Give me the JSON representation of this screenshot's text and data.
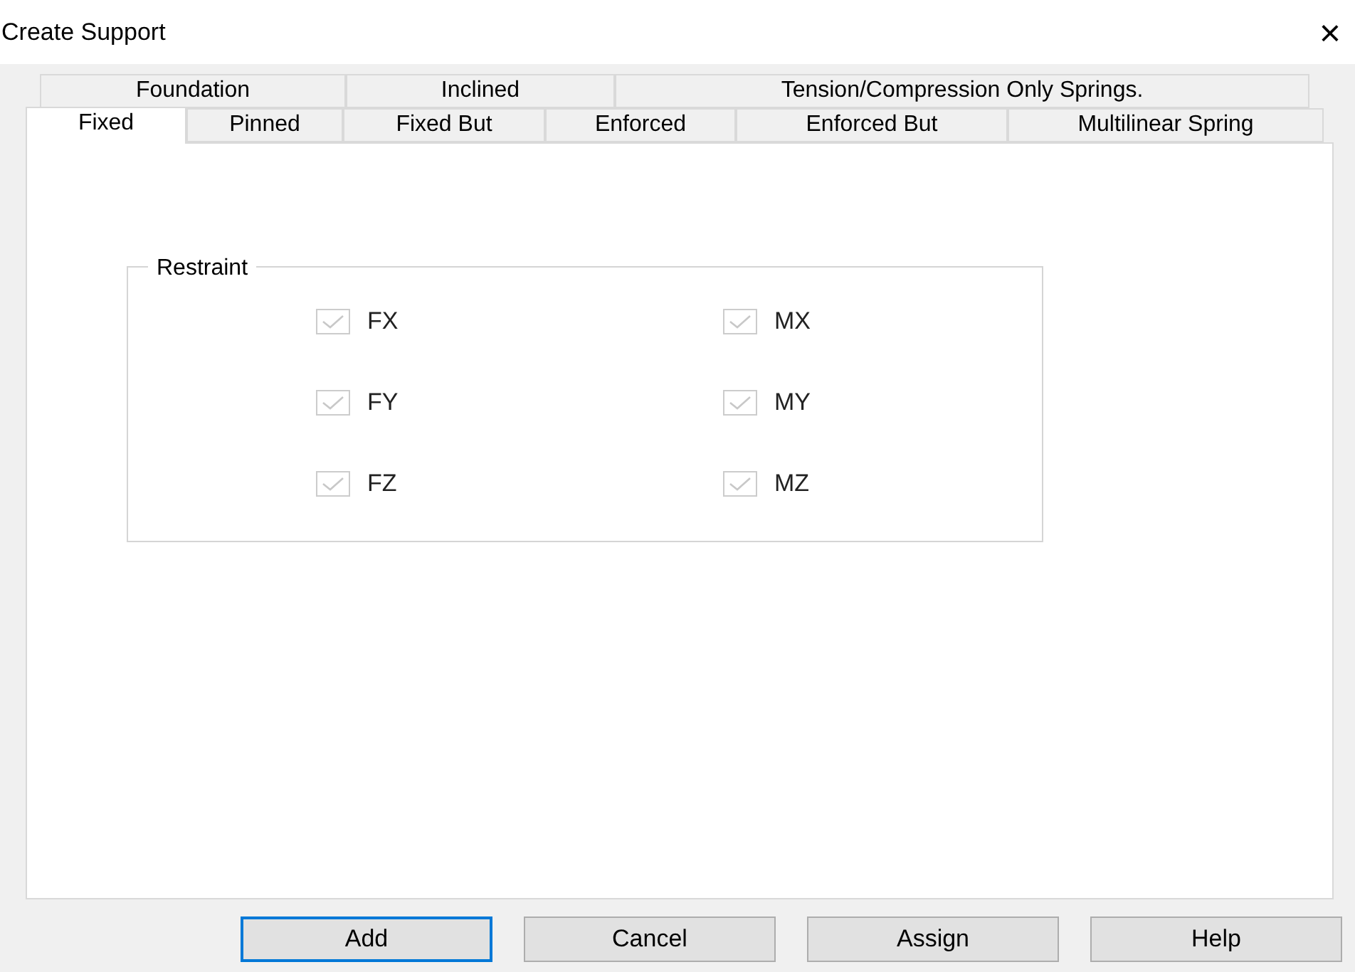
{
  "window": {
    "title": "Create Support",
    "close": "×"
  },
  "tab_rows": [
    {
      "tabs": [
        {
          "label": "Foundation",
          "selected": false
        },
        {
          "label": "Inclined",
          "selected": false
        },
        {
          "label": "Tension/Compression Only Springs.",
          "selected": false
        }
      ]
    },
    {
      "tabs": [
        {
          "label": "Fixed",
          "selected": true
        },
        {
          "label": "Pinned",
          "selected": false
        },
        {
          "label": "Fixed But",
          "selected": false
        },
        {
          "label": "Enforced",
          "selected": false
        },
        {
          "label": "Enforced But",
          "selected": false
        },
        {
          "label": "Multilinear Spring",
          "selected": false
        }
      ]
    }
  ],
  "restraint": {
    "title": "Restraint",
    "items": [
      {
        "label": "FX",
        "checked": true,
        "disabled": true
      },
      {
        "label": "MX",
        "checked": true,
        "disabled": true
      },
      {
        "label": "FY",
        "checked": true,
        "disabled": true
      },
      {
        "label": "MY",
        "checked": true,
        "disabled": true
      },
      {
        "label": "FZ",
        "checked": true,
        "disabled": true
      },
      {
        "label": "MZ",
        "checked": true,
        "disabled": true
      }
    ]
  },
  "buttons": [
    {
      "label": "Add",
      "focused": true
    },
    {
      "label": "Cancel",
      "focused": false
    },
    {
      "label": "Assign",
      "focused": false
    },
    {
      "label": "Help",
      "focused": false
    }
  ]
}
